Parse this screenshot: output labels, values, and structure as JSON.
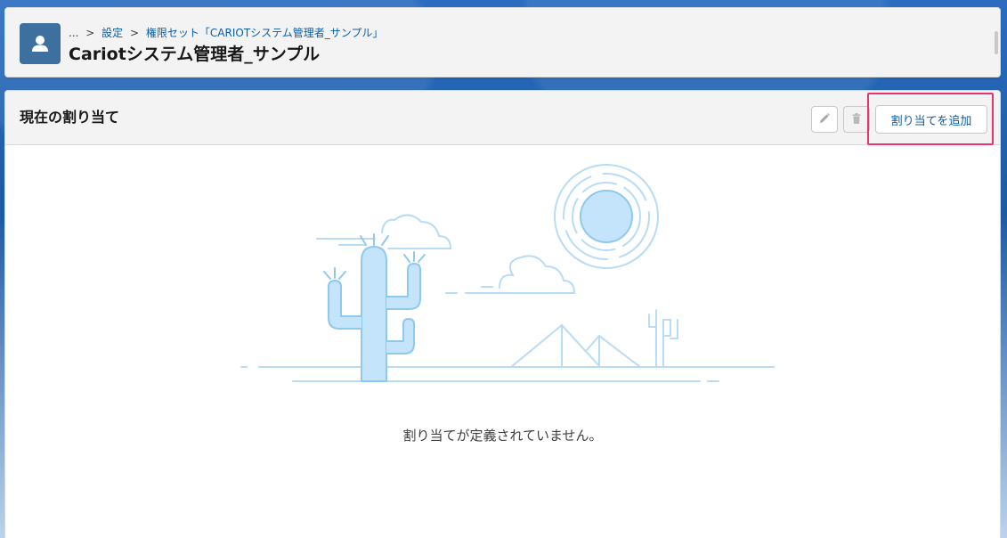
{
  "header": {
    "breadcrumb": {
      "ellipsis": "...",
      "separator": ">",
      "setup": "設定",
      "current": "権限セット「CARIOTシステム管理者_サンプル」"
    },
    "title": "Cariotシステム管理者_サンプル",
    "icon": "user-icon"
  },
  "card": {
    "title": "現在の割り当て",
    "actions": {
      "edit_icon": "pencil-icon",
      "delete_icon": "trash-icon",
      "add_label": "割り当てを追加"
    },
    "empty_message": "割り当てが定義されていません。",
    "illustration": "desert-empty-state"
  },
  "colors": {
    "link": "#0b5cab",
    "highlight": "#e8336e",
    "header_icon_bg": "#3d6f9f",
    "illustration_stroke": "#b8dcf5",
    "illustration_fill": "#c3e4fa"
  }
}
